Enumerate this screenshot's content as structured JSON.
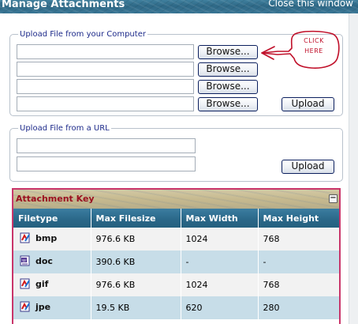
{
  "window": {
    "title": "Manage Attachments",
    "close_label": "Close this window"
  },
  "upload_computer": {
    "legend": "Upload File from your Computer",
    "browse_label": "Browse...",
    "upload_label": "Upload",
    "file_fields": [
      "",
      "",
      "",
      ""
    ]
  },
  "callout": {
    "line1": "CLICK",
    "line2": "HERE",
    "color": "#c0102a"
  },
  "upload_url": {
    "legend": "Upload File from a URL",
    "upload_label": "Upload",
    "url_fields": [
      "",
      ""
    ]
  },
  "attachment_key": {
    "title": "Attachment Key",
    "collapse_symbol": "−",
    "columns": [
      "Filetype",
      "Max Filesize",
      "Max Width",
      "Max Height"
    ],
    "rows": [
      {
        "ext": "bmp",
        "icon": "image-file-icon",
        "filesize": "976.6 KB",
        "width": "1024",
        "height": "768"
      },
      {
        "ext": "doc",
        "icon": "word-document-icon",
        "filesize": "390.6 KB",
        "width": "-",
        "height": "-"
      },
      {
        "ext": "gif",
        "icon": "image-file-icon",
        "filesize": "976.6 KB",
        "width": "1024",
        "height": "768"
      },
      {
        "ext": "jpe",
        "icon": "image-file-icon",
        "filesize": "19.5 KB",
        "width": "620",
        "height": "280"
      }
    ]
  },
  "colors": {
    "accent_header": "#2a6788",
    "row_odd": "#f2f2f2",
    "row_even": "#c7dde8",
    "panel_border": "#c9356a"
  }
}
